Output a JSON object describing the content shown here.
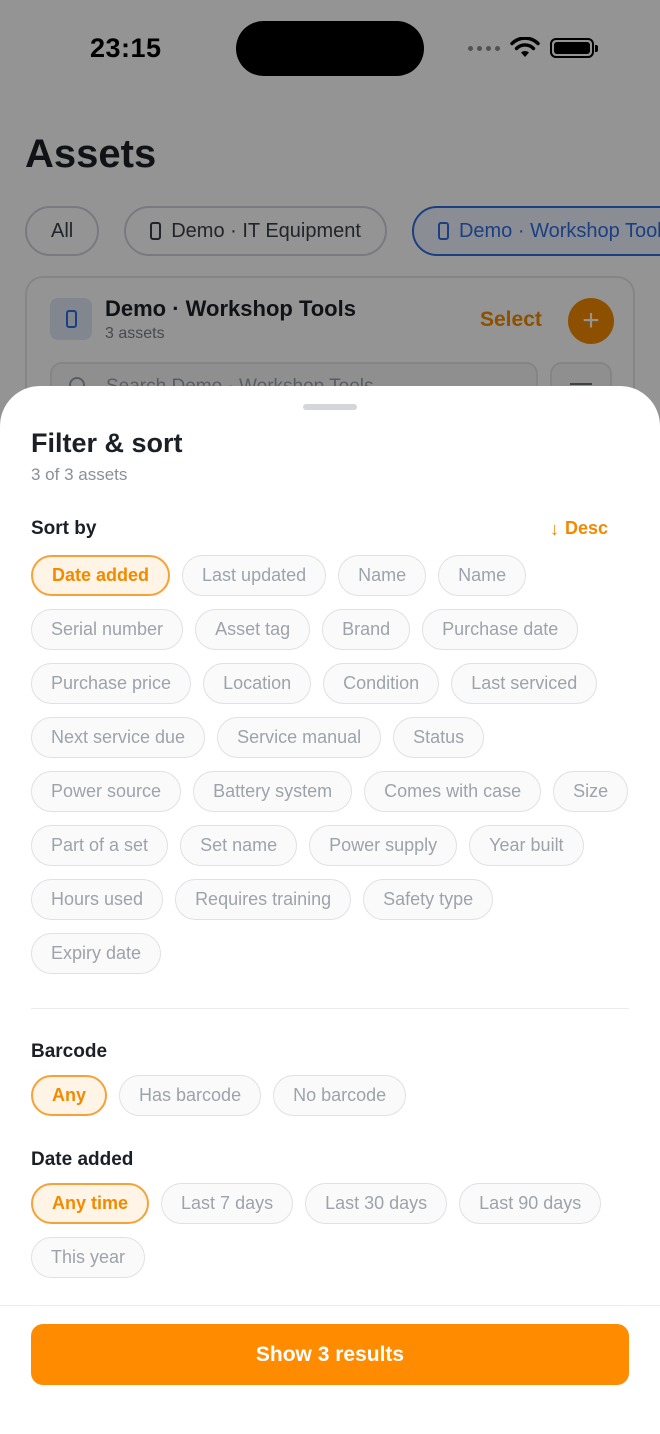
{
  "status_bar": {
    "time": "23:15"
  },
  "background": {
    "page_title": "Assets",
    "tabs": [
      {
        "label": "All"
      },
      {
        "label": "Demo · IT Equipment"
      },
      {
        "label": "Demo · Workshop Tools"
      }
    ],
    "card": {
      "title": "Demo · Workshop Tools",
      "subtitle": "3 assets",
      "select_label": "Select",
      "add_label": "+",
      "search_placeholder": "Search Demo · Workshop Tools"
    }
  },
  "sheet": {
    "title": "Filter & sort",
    "count": "3 of 3 assets",
    "sort": {
      "label": "Sort by",
      "direction": "Desc",
      "options": [
        "Date added",
        "Last updated",
        "Name",
        "Name",
        "Serial number",
        "Asset tag",
        "Brand",
        "Purchase date",
        "Purchase price",
        "Location",
        "Condition",
        "Last serviced",
        "Next service due",
        "Service manual",
        "Status",
        "Power source",
        "Battery system",
        "Comes with case",
        "Size",
        "Part of a set",
        "Set name",
        "Power supply",
        "Year built",
        "Hours used",
        "Requires training",
        "Safety type",
        "Expiry date"
      ],
      "selected": "Date added"
    },
    "barcode": {
      "label": "Barcode",
      "options": [
        "Any",
        "Has barcode",
        "No barcode"
      ],
      "selected": "Any"
    },
    "date_added": {
      "label": "Date added",
      "options": [
        "Any time",
        "Last 7 days",
        "Last 30 days",
        "Last 90 days",
        "This year"
      ],
      "selected": "Any time"
    },
    "show_button": "Show 3 results"
  },
  "colors": {
    "accent": "#f28a00",
    "button": "#ff8c00",
    "tab_active": "#2f6fe0"
  }
}
